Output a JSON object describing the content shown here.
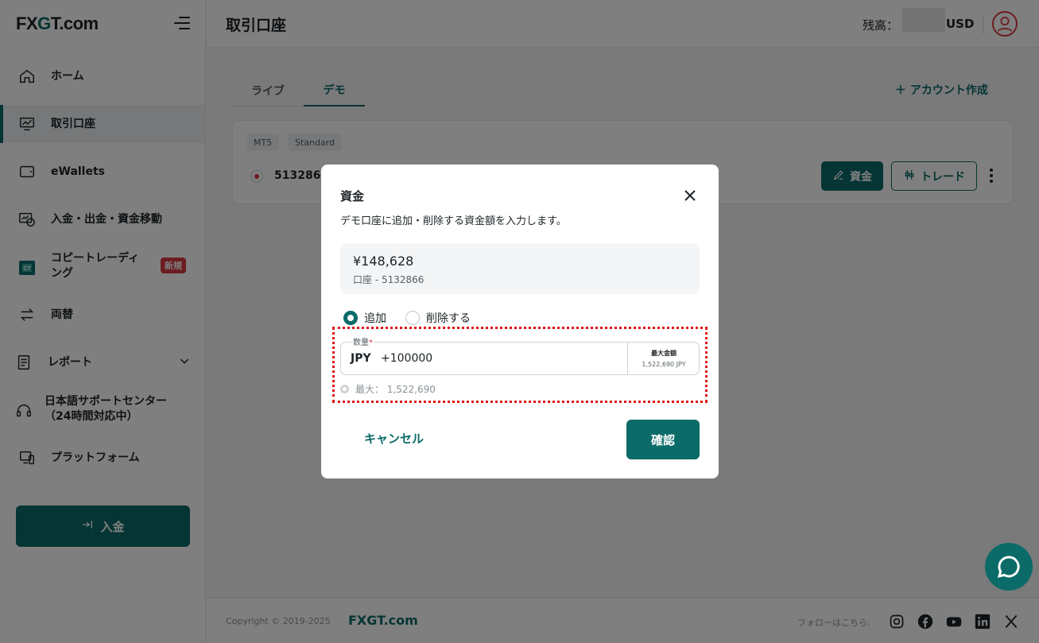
{
  "brand": {
    "logo": "FXGT.com",
    "accent": "#0b6b68",
    "danger": "#d93842"
  },
  "sidebar": {
    "items": [
      {
        "label": "ホーム",
        "icon": "home-icon"
      },
      {
        "label": "取引口座",
        "icon": "trading-account-icon",
        "active": true
      },
      {
        "label": "eWallets",
        "icon": "wallet-icon"
      },
      {
        "label": "入金・出金・資金移動",
        "icon": "funds-transfer-icon"
      },
      {
        "label": "コピートレーディング",
        "icon": "copy-trading-icon",
        "badge": "新規"
      },
      {
        "label": "両替",
        "icon": "exchange-icon"
      },
      {
        "label": "レポート",
        "icon": "report-icon"
      },
      {
        "label": "日本語サポートセンター（24時間対応中）",
        "icon": "headset-icon"
      },
      {
        "label": "プラットフォーム",
        "icon": "platform-icon"
      }
    ],
    "copy_line1": "コピートレーディ",
    "copy_line2": "ング",
    "support_line1": "日本語サポートセンター",
    "support_line2": "（24時間対応中）",
    "deposit_button": "入金"
  },
  "header": {
    "title": "取引口座",
    "balance_label": "残高：",
    "currency": "USD"
  },
  "main": {
    "tabs": [
      {
        "label": "ライブ"
      },
      {
        "label": "デモ",
        "active": true
      }
    ],
    "create_account": "アカウント作成",
    "account": {
      "platform": "MT5",
      "type": "Standard",
      "number": "5132866",
      "fund_button": "資金",
      "trade_button": "トレード"
    }
  },
  "footer": {
    "copyright": "Copyright © 2019-2025",
    "logo": "FXGT.com",
    "follow": "フォローはこちら:"
  },
  "modal": {
    "title": "資金",
    "description": "デモ口座に追加・削除する資金額を入力します。",
    "balance": "¥148,628",
    "account_line": "口座 - 5132866",
    "radio_add": "追加",
    "radio_remove": "削除する",
    "amount_label": "数量",
    "required_mark": "*",
    "currency": "JPY",
    "amount_value": "+100000",
    "max_title": "最大金額",
    "max_value": "1,522,690 JPY",
    "max_hint": "最大： 1,522,690",
    "cancel": "キャンセル",
    "confirm": "確認"
  }
}
